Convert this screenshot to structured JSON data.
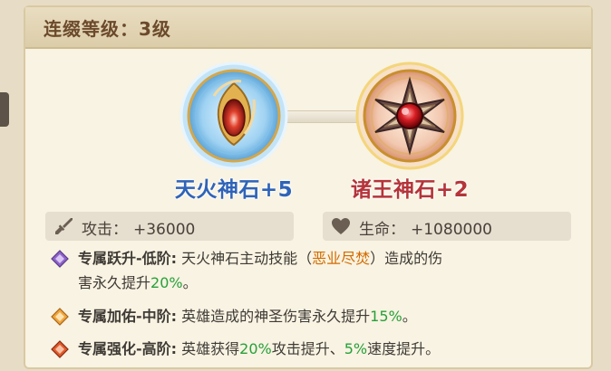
{
  "title": "连缀等级：3级",
  "stones": [
    {
      "name": "天火神石+5",
      "style": "blue"
    },
    {
      "name": "诸王神石+2",
      "style": "red"
    }
  ],
  "stats": [
    {
      "icon": "sword-icon",
      "label": "攻击：",
      "value": "+36000"
    },
    {
      "icon": "heart-icon",
      "label": "生命：",
      "value": "+1080000"
    }
  ],
  "effects": [
    {
      "icon": "purple-diamond-icon",
      "head": "专属跃升-低阶:",
      "line1_a": " 天火神石主动技能（",
      "line1_skill": "恶业尽焚",
      "line1_b": "）造成的伤",
      "line2_a": "害永久提升",
      "line2_pct": "20%",
      "line2_b": "。"
    },
    {
      "icon": "orange-diamond-icon",
      "head": "专属加佑-中阶:",
      "text_a": " 英雄造成的神圣伤害永久提升",
      "pct": "15%",
      "text_b": "。"
    },
    {
      "icon": "red-diamond-icon",
      "head": "专属强化-高阶:",
      "text_a": " 英雄获得",
      "pct1": "20%",
      "text_b": "攻击提升、",
      "pct2": "5%",
      "text_c": "速度提升。"
    }
  ],
  "colors": {
    "highlight_green": "#27a03a",
    "highlight_orange": "#d36b00",
    "stone1_label": "#2f63b8",
    "stone2_label": "#b4343a"
  }
}
